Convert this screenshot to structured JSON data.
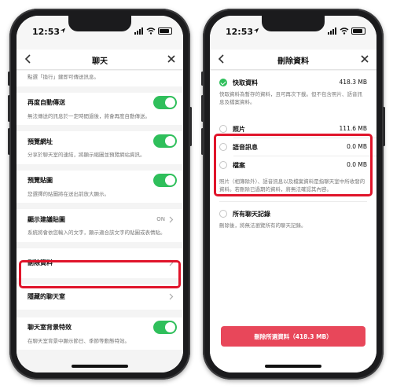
{
  "left_screen": {
    "status": {
      "time": "12:53"
    },
    "nav": {
      "title": "聊天"
    },
    "intro_desc": "點選「換行」鍵即可傳送訊息。",
    "items": [
      {
        "label": "再度自動傳送",
        "desc": "無法傳送的訊息於一定時間過後，將會再度自動傳送。"
      },
      {
        "label": "預覽網址",
        "desc": "分享於聊天室的連結，將顯示縮圖並預覽網站資訊。"
      },
      {
        "label": "預覽貼圖",
        "desc": "您選擇的貼圖將在送出前放大顯示。"
      },
      {
        "label": "顯示建議貼圖",
        "value": "ON",
        "desc": "系統將會依您輸入的文字，顯示適合該文字的貼圖或表情貼。"
      },
      {
        "label": "刪除資料"
      },
      {
        "label": "隱藏的聊天室"
      },
      {
        "label": "聊天室背景特效",
        "desc": "在聊天室背景中顯示節日、季節等動態特效。"
      }
    ]
  },
  "right_screen": {
    "status": {
      "time": "12:53"
    },
    "nav": {
      "title": "刪除資料"
    },
    "cache": {
      "label": "快取資料",
      "value": "418.3 MB",
      "desc": "快取資料為暫存的資料，且可再次下載。但不包含照片、語音訊息及檔案資料。"
    },
    "files": [
      {
        "label": "照片",
        "value": "111.6 MB"
      },
      {
        "label": "語音訊息",
        "value": "0.0 MB"
      },
      {
        "label": "檔案",
        "value": "0.0 MB"
      }
    ],
    "files_desc": "照片（相簿除外）、語音訊息以及檔案資料是指聊天室中所收發的資料。若刪除已過期的資料，將無法確認其內容。",
    "all_chats": {
      "label": "所有聊天記錄",
      "desc": "刪除後，將無法瀏覽所有的聊天記錄。"
    },
    "delete_button": "刪除所選資料（418.3 MB）"
  },
  "colors": {
    "toggle_on": "#2fbf5b",
    "highlight": "#e0142a",
    "danger_button": "#e8475a"
  }
}
